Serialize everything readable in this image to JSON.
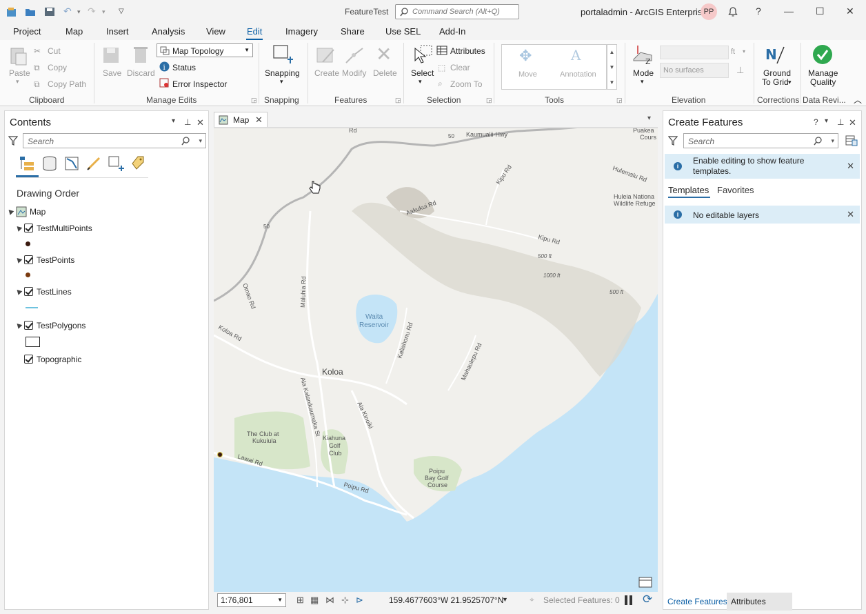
{
  "app": {
    "window_title": "FeatureTest",
    "command_search_placeholder": "Command Search (Alt+Q)",
    "portal": "portaladmin - ArcGIS Enterprise",
    "user_initials": "PP"
  },
  "ribbon_tabs": [
    "Project",
    "Map",
    "Insert",
    "Analysis",
    "View",
    "Edit",
    "Imagery",
    "Share",
    "Use SEL",
    "Add-In"
  ],
  "active_tab": "Edit",
  "ribbon": {
    "clipboard": {
      "label": "Clipboard",
      "paste": "Paste",
      "cut": "Cut",
      "copy": "Copy",
      "copy_path": "Copy Path"
    },
    "manage_edits": {
      "label": "Manage Edits",
      "save": "Save",
      "discard": "Discard",
      "topology": "Map Topology",
      "status": "Status",
      "error_inspector": "Error Inspector"
    },
    "snapping": {
      "label": "Snapping",
      "button": "Snapping"
    },
    "features": {
      "label": "Features",
      "create": "Create",
      "modify": "Modify",
      "delete": "Delete"
    },
    "selection": {
      "label": "Selection",
      "select": "Select",
      "attributes": "Attributes",
      "clear": "Clear",
      "zoom_to": "Zoom To"
    },
    "tools": {
      "label": "Tools",
      "move": "Move",
      "annotation": "Annotation"
    },
    "elevation": {
      "label": "Elevation",
      "mode": "Mode",
      "unit": "ft",
      "surface": "No surfaces"
    },
    "corrections": {
      "label": "Corrections",
      "ground_to_grid_1": "Ground",
      "ground_to_grid_2": "To Grid"
    },
    "data_reviewer": {
      "label": "Data Revi...",
      "manage_quality_1": "Manage",
      "manage_quality_2": "Quality"
    }
  },
  "contents": {
    "title": "Contents",
    "search_placeholder": "Search",
    "section": "Drawing Order",
    "map_name": "Map",
    "layers": [
      {
        "name": "TestMultiPoints"
      },
      {
        "name": "TestPoints"
      },
      {
        "name": "TestLines"
      },
      {
        "name": "TestPolygons"
      },
      {
        "name": "Topographic"
      }
    ]
  },
  "map": {
    "tab_label": "Map",
    "scale": "1:76,801",
    "coordinates": "159.4677603°W 21.9525707°N",
    "selected_features": "Selected Features: 0",
    "labels": {
      "kaumualii": "Kaumualii-Hwy",
      "hwy50a": "50",
      "hwy50b": "50",
      "rd_top": "Rd",
      "kipu_rd1": "Kipu Rd",
      "kipu_rd2": "Kipu Rd",
      "aakukui": "Aakukui Rd",
      "hulemalu": "Hulemalu Rd",
      "puakea1": "Puakea",
      "puakea2": "Cours",
      "huleia1": "Huleia Nationa",
      "huleia2": "Wildlife Refuge",
      "ft500a": "500 ft",
      "ft1000": "1000 ft",
      "ft500b": "500 ft",
      "omao": "Omao Rd",
      "maluhia": "Maluhia Rd",
      "waita1": "Waita",
      "waita2": "Reservoir",
      "kahili": "Kaliahonu Rd",
      "mahaulepu": "Mahaulepu Rd",
      "koloa_rd": "Koloa Rd",
      "koloa": "Koloa",
      "kalanikaumaka": "Ala Kalanikaumaka St",
      "alakinoiki": "Ala Kinoiki",
      "club1": "The Club at",
      "club2": "Kukuiula",
      "kiahuna1": "Kiahuna",
      "kiahuna2": "Golf",
      "kiahuna3": "Club",
      "poipu_bay1": "Poipu",
      "poipu_bay2": "Bay Golf",
      "poipu_bay3": "Course",
      "lawai": "Lawai Rd",
      "poipu_rd": "Poipu Rd"
    }
  },
  "create_features": {
    "title": "Create Features",
    "search_placeholder": "Search",
    "banner1_line1": "Enable editing to show feature",
    "banner1_line2": "templates.",
    "tab_templates": "Templates",
    "tab_favorites": "Favorites",
    "banner2": "No editable layers"
  },
  "bottom_tabs": {
    "create_features": "Create Features",
    "attributes": "Attributes"
  },
  "colors": {
    "accent": "#0b5fa5",
    "land": "#f1f0ec",
    "water": "#c4e4f7",
    "park": "#d7e6c9",
    "info_banner": "#dcedf7"
  }
}
